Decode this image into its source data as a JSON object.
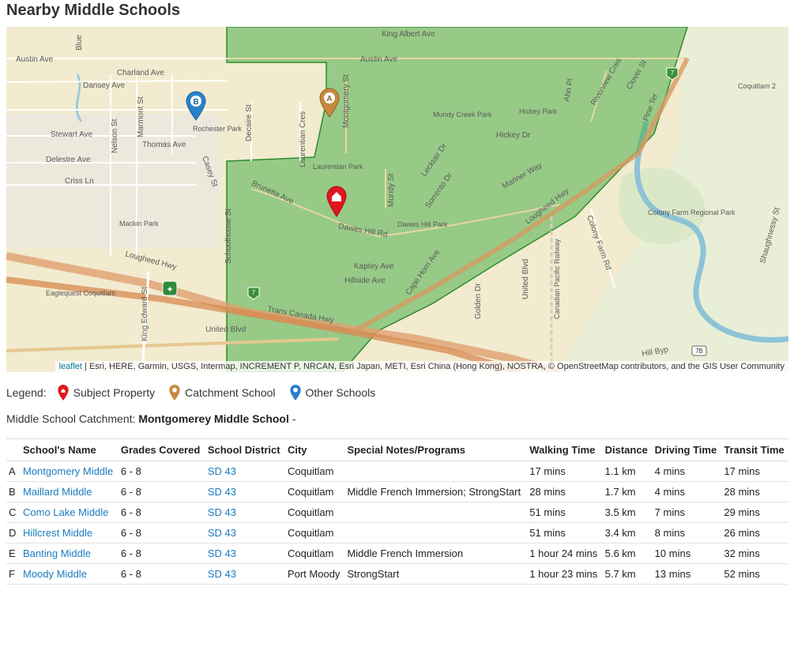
{
  "page": {
    "title": "Nearby Middle Schools"
  },
  "map": {
    "attribution_link": "leaflet",
    "attribution_text": "| Esri, HERE, Garmin, USGS, Intermap, INCREMENT P, NRCAN, Esri Japan, METI, Esri China (Hong Kong), NOSTRA, © OpenStreetMap contributors, and the GIS User Community",
    "markers": {
      "a": "A",
      "b": "B"
    },
    "labels": {
      "king_albert": "King Albert Ave",
      "austin_w": "Austin Ave",
      "austin_e": "Austin Ave",
      "charland": "Charland Ave",
      "dansey": "Dansey Ave",
      "stewart": "Stewart Ave",
      "thomas": "Thomas Ave",
      "delestre": "Delestre Ave",
      "criss": "Criss Ln",
      "nelson": "Nelson St",
      "marmont": "Marmont St",
      "decaire": "Decaire St",
      "laurentian_cres": "Laurentian Cres",
      "montgomery_st": "Montgomery St",
      "rochester_park": "Rochester Park",
      "laurentian_park": "Laurentian Park",
      "mundy_creek_park": "Mundy Creek Park",
      "hickey_park": "Hickey Park",
      "hickey_dr": "Hickey Dr",
      "mundy_st": "Mundy St",
      "lecktair": "Lecktair Dr",
      "sorrento": "Sorrento Dr",
      "mariner": "Mariner Way",
      "brunette": "Brunette Ave",
      "dawes_hill_rd": "Dawes Hill Rd",
      "dawes_hill_park": "Dawes Hill Park",
      "kaptey": "Kaptey Ave",
      "hillside": "Hillside Ave",
      "cape_horn": "Cape Horn Ave",
      "lougheed_w": "Lougheed Hwy",
      "lougheed_e": "Lougheed Hwy",
      "trans_canada": "Trans Canada Hwy",
      "united_blvd_w": "United Blvd",
      "united_blvd_n": "United Blvd",
      "king_edward": "King Edward St",
      "schoolhouse": "Schoolhouse St",
      "mackin_park": "Mackin Park",
      "eaglequest": "Eaglequest Coquitlam",
      "golden": "Golden Dr",
      "cp_railway": "Canadian Pacific Railway",
      "colony_farm_rd": "Colony Farm Rd",
      "colony_farm_park": "Colony Farm Regional Park",
      "shaughnessy": "Shaughnessy St",
      "coquitlam2": "Coquitlam 2",
      "hill_byp": "Hill Byp",
      "casey": "Casey St",
      "pine_ter": "Pine Ter",
      "clover": "Clover St",
      "riverview": "Riverview Cres",
      "ahn_pl": "Ahn Pl",
      "blue": "Blue",
      "shield_7": "7",
      "shield_7b": "7B"
    }
  },
  "legend": {
    "label": "Legend:",
    "items": [
      {
        "name": "Subject Property",
        "color": "#e0161e"
      },
      {
        "name": "Catchment School",
        "color": "#c7893d"
      },
      {
        "name": "Other Schools",
        "color": "#2a81cb"
      }
    ]
  },
  "catchment": {
    "prefix": "Middle School Catchment:",
    "school": "Montgomerey Middle School",
    "suffix": " -"
  },
  "table": {
    "headers": [
      "School's Name",
      "Grades Covered",
      "School District",
      "City",
      "Special Notes/Programs",
      "Walking Time",
      "Distance",
      "Driving Time",
      "Transit Time"
    ],
    "rows": [
      {
        "letter": "A",
        "name": "Montgomery Middle",
        "grades": "6 - 8",
        "district": "SD 43",
        "city": "Coquitlam",
        "notes": "",
        "walking": "17 mins",
        "distance": "1.1 km",
        "driving": "4 mins",
        "transit": "17 mins"
      },
      {
        "letter": "B",
        "name": "Maillard Middle",
        "grades": "6 - 8",
        "district": "SD 43",
        "city": "Coquitlam",
        "notes": "Middle French Immersion; StrongStart",
        "walking": "28 mins",
        "distance": "1.7 km",
        "driving": "4 mins",
        "transit": "28 mins"
      },
      {
        "letter": "C",
        "name": "Como Lake Middle",
        "grades": "6 - 8",
        "district": "SD 43",
        "city": "Coquitlam",
        "notes": "",
        "walking": "51 mins",
        "distance": "3.5 km",
        "driving": "7 mins",
        "transit": "29 mins"
      },
      {
        "letter": "D",
        "name": "Hillcrest Middle",
        "grades": "6 - 8",
        "district": "SD 43",
        "city": "Coquitlam",
        "notes": "",
        "walking": "51 mins",
        "distance": "3.4 km",
        "driving": "8 mins",
        "transit": "26 mins"
      },
      {
        "letter": "E",
        "name": "Banting Middle",
        "grades": "6 - 8",
        "district": "SD 43",
        "city": "Coquitlam",
        "notes": "Middle French Immersion",
        "walking": "1 hour 24 mins",
        "distance": "5.6 km",
        "driving": "10 mins",
        "transit": "32 mins"
      },
      {
        "letter": "F",
        "name": "Moody Middle",
        "grades": "6 - 8",
        "district": "SD 43",
        "city": "Port Moody",
        "notes": "StrongStart",
        "walking": "1 hour 23 mins",
        "distance": "5.7 km",
        "driving": "13 mins",
        "transit": "52 mins"
      }
    ]
  }
}
